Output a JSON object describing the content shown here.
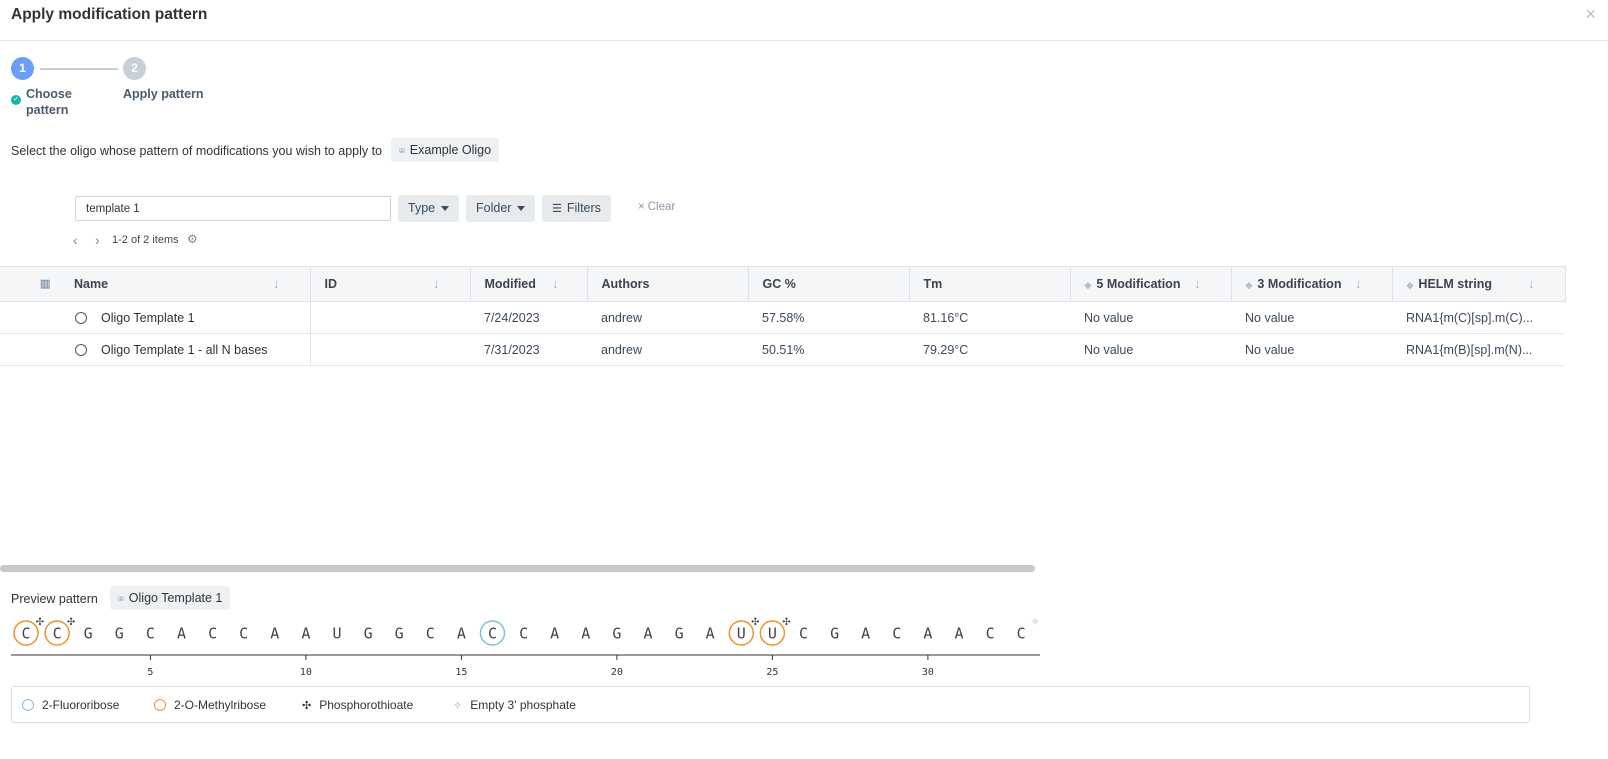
{
  "dialog": {
    "title": "Apply modification pattern",
    "close_icon": "×"
  },
  "steps": [
    {
      "number": "1",
      "label": "Choose pattern",
      "label_line1": "Choose",
      "label_line2": "pattern",
      "state": "complete"
    },
    {
      "number": "2",
      "label": "Apply pattern",
      "state": "pending"
    }
  ],
  "instruction": {
    "text": "Select the oligo whose pattern of modifications you wish to apply to",
    "target_chip": "Example Oligo"
  },
  "search": {
    "value": "template 1"
  },
  "filters": {
    "type_label": "Type",
    "folder_label": "Folder",
    "filters_label": "Filters",
    "clear_label": "Clear"
  },
  "pagination": {
    "summary": "1-2 of 2 items"
  },
  "table": {
    "columns": [
      "Name",
      "ID",
      "Modified",
      "Authors",
      "GC %",
      "Tm",
      "5 Modification",
      "3 Modification",
      "HELM string"
    ],
    "rows": [
      {
        "name": "Oligo Template 1",
        "id": "",
        "modified": "7/24/2023",
        "authors": "andrew",
        "gc": "57.58%",
        "tm": "81.16°C",
        "mod5": "No value",
        "mod3": "No value",
        "helm": "RNA1{m(C)[sp].m(C)..."
      },
      {
        "name": "Oligo Template 1 - all N bases",
        "id": "",
        "modified": "7/31/2023",
        "authors": "andrew",
        "gc": "50.51%",
        "tm": "79.29°C",
        "mod5": "No value",
        "mod3": "No value",
        "helm": "RNA1{m(B)[sp].m(N)..."
      }
    ]
  },
  "preview": {
    "label": "Preview pattern",
    "chip": "Oligo Template 1",
    "bases": [
      {
        "b": "C",
        "mod": "methyl",
        "ps": true
      },
      {
        "b": "C",
        "mod": "methyl",
        "ps": true
      },
      {
        "b": "G",
        "mod": "none",
        "ps": false
      },
      {
        "b": "G",
        "mod": "none",
        "ps": false
      },
      {
        "b": "C",
        "mod": "none",
        "ps": false
      },
      {
        "b": "A",
        "mod": "none",
        "ps": false
      },
      {
        "b": "C",
        "mod": "none",
        "ps": false
      },
      {
        "b": "C",
        "mod": "none",
        "ps": false
      },
      {
        "b": "A",
        "mod": "none",
        "ps": false
      },
      {
        "b": "A",
        "mod": "none",
        "ps": false
      },
      {
        "b": "U",
        "mod": "none",
        "ps": false
      },
      {
        "b": "G",
        "mod": "none",
        "ps": false
      },
      {
        "b": "G",
        "mod": "none",
        "ps": false
      },
      {
        "b": "C",
        "mod": "none",
        "ps": false
      },
      {
        "b": "A",
        "mod": "none",
        "ps": false
      },
      {
        "b": "C",
        "mod": "fluoro",
        "ps": false
      },
      {
        "b": "C",
        "mod": "none",
        "ps": false
      },
      {
        "b": "A",
        "mod": "none",
        "ps": false
      },
      {
        "b": "A",
        "mod": "none",
        "ps": false
      },
      {
        "b": "G",
        "mod": "none",
        "ps": false
      },
      {
        "b": "A",
        "mod": "none",
        "ps": false
      },
      {
        "b": "G",
        "mod": "none",
        "ps": false
      },
      {
        "b": "A",
        "mod": "none",
        "ps": false
      },
      {
        "b": "U",
        "mod": "methyl",
        "ps": true
      },
      {
        "b": "U",
        "mod": "methyl",
        "ps": true
      },
      {
        "b": "C",
        "mod": "none",
        "ps": false
      },
      {
        "b": "G",
        "mod": "none",
        "ps": false
      },
      {
        "b": "A",
        "mod": "none",
        "ps": false
      },
      {
        "b": "C",
        "mod": "none",
        "ps": false
      },
      {
        "b": "A",
        "mod": "none",
        "ps": false
      },
      {
        "b": "A",
        "mod": "none",
        "ps": false
      },
      {
        "b": "C",
        "mod": "none",
        "ps": false
      },
      {
        "b": "C",
        "mod": "none",
        "ps": false,
        "empty3": true
      }
    ],
    "ticks": [
      "5",
      "10",
      "15",
      "20",
      "25",
      "30"
    ]
  },
  "legend": [
    {
      "label": "2-Fluororibose",
      "kind": "fluoro"
    },
    {
      "label": "2-O-Methylribose",
      "kind": "methyl"
    },
    {
      "label": "Phosphorothioate",
      "kind": "ps"
    },
    {
      "label": "Empty 3' phosphate",
      "kind": "empty3"
    }
  ],
  "colors": {
    "fluoro": "#7fc2d9",
    "methyl": "#f0932b",
    "step_active": "#6c9df5",
    "step_done_check": "#18b6a4"
  }
}
